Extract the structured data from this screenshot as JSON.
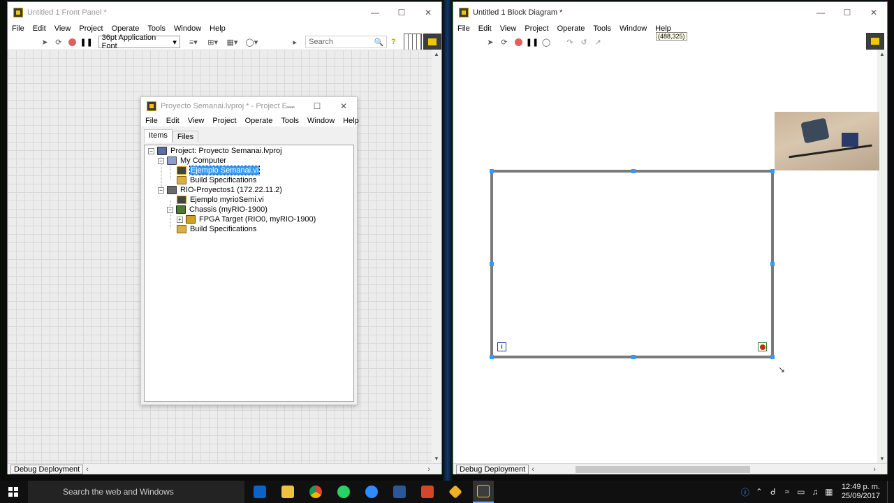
{
  "front_panel": {
    "title": "Untitled 1 Front Panel *",
    "menu": [
      "File",
      "Edit",
      "View",
      "Project",
      "Operate",
      "Tools",
      "Window",
      "Help"
    ],
    "font_select": "36pt Application Font",
    "search_placeholder": "Search",
    "status_target": "Debug Deployment"
  },
  "block_diagram": {
    "title": "Untitled 1 Block Diagram *",
    "menu": [
      "File",
      "Edit",
      "View",
      "Project",
      "Operate",
      "Tools",
      "Window",
      "Help"
    ],
    "coords": "(488,325)",
    "status_target": "Debug Deployment"
  },
  "project_explorer": {
    "title": "Proyecto Semanai.lvproj * - Project E...",
    "menu": [
      "File",
      "Edit",
      "View",
      "Project",
      "Operate",
      "Tools",
      "Window",
      "Help"
    ],
    "tabs": [
      "Items",
      "Files"
    ],
    "tree": [
      {
        "label": "Project: Proyecto Semanai.lvproj",
        "icon": "project-icon"
      },
      {
        "label": "My Computer",
        "icon": "computer-icon"
      },
      {
        "label": "Ejemplo Semanai.vi",
        "icon": "vi-icon",
        "selected": true
      },
      {
        "label": "Build Specifications",
        "icon": "build-icon"
      },
      {
        "label": "RIO-Proyectos1 (172.22.11.2)",
        "icon": "rio-target-icon"
      },
      {
        "label": "Ejemplo myrioSemi.vi",
        "icon": "vi-icon"
      },
      {
        "label": "Chassis (myRIO-1900)",
        "icon": "chassis-icon"
      },
      {
        "label": "FPGA Target (RIO0, myRIO-1900)",
        "icon": "fpga-icon"
      },
      {
        "label": "Build Specifications",
        "icon": "build-icon"
      }
    ]
  },
  "taskbar": {
    "search": "Search the web and Windows",
    "time": "12:49 p. m.",
    "date": "25/09/2017",
    "apps": [
      "outlook-icon",
      "file-explorer-icon",
      "chrome-icon",
      "whatsapp-icon",
      "zoom-icon",
      "word-icon",
      "powerpoint-icon",
      "tool-icon",
      "labview-icon"
    ]
  }
}
